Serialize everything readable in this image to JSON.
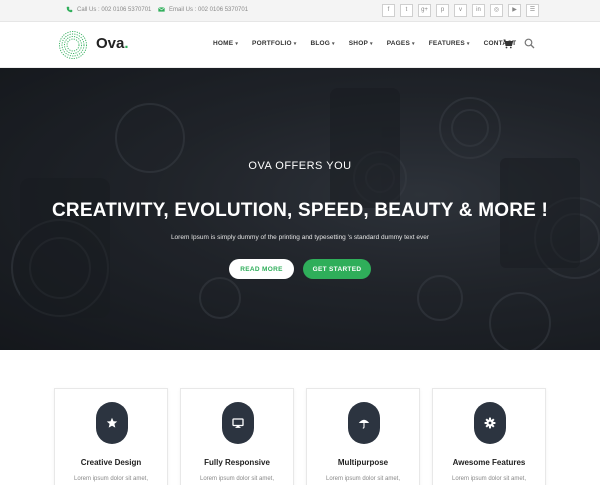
{
  "topbar": {
    "phone_text": "Call Us : 002 0106 5370701",
    "mail_text": "Email Us : 002 0106 5370701",
    "social_icons": [
      {
        "name": "facebook-icon",
        "glyph": "f"
      },
      {
        "name": "twitter-icon",
        "glyph": "t"
      },
      {
        "name": "google-plus-icon",
        "glyph": "g+"
      },
      {
        "name": "pinterest-icon",
        "glyph": "p"
      },
      {
        "name": "vine-icon",
        "glyph": "v"
      },
      {
        "name": "linkedin-icon",
        "glyph": "in"
      },
      {
        "name": "dribbble-icon",
        "glyph": "◎"
      },
      {
        "name": "youtube-icon",
        "glyph": "▶"
      },
      {
        "name": "rss-icon",
        "glyph": "☰"
      }
    ]
  },
  "nav": {
    "brand": "Ova",
    "brand_dot": ".",
    "items": [
      {
        "label": "HOME",
        "dropdown": true
      },
      {
        "label": "PORTFOLIO",
        "dropdown": true
      },
      {
        "label": "BLOG",
        "dropdown": true
      },
      {
        "label": "SHOP",
        "dropdown": true
      },
      {
        "label": "PAGES",
        "dropdown": true
      },
      {
        "label": "FEATURES",
        "dropdown": true
      },
      {
        "label": "CONTACT",
        "dropdown": false
      }
    ],
    "dropdown_glyph": "▾",
    "cart_icon": "cart-icon",
    "search_icon": "search-icon"
  },
  "hero": {
    "eyebrow": "OVA OFFERS YOU",
    "headline": "CREATIVITY, EVOLUTION, SPEED, BEAUTY & MORE !",
    "subline": "Lorem Ipsum is simply dummy of the printing and typesetting 's standard dummy text ever",
    "read_more": "READ MORE",
    "get_started": "GET STARTED"
  },
  "features": [
    {
      "title": "Creative Design",
      "text": "Lorem ipsum dolor sit amet,",
      "icon": "star-icon"
    },
    {
      "title": "Fully Responsive",
      "text": "Lorem ipsum dolor sit amet,",
      "icon": "monitor-icon"
    },
    {
      "title": "Multipurpose",
      "text": "Lorem ipsum dolor sit amet,",
      "icon": "umbrella-icon"
    },
    {
      "title": "Awesome Features",
      "text": "Lorem ipsum dolor sit amet,",
      "icon": "gear-icon"
    }
  ],
  "colors": {
    "accent": "#2fae5a",
    "dark": "#2c3440",
    "topbar_bg": "#f4f4f4"
  }
}
